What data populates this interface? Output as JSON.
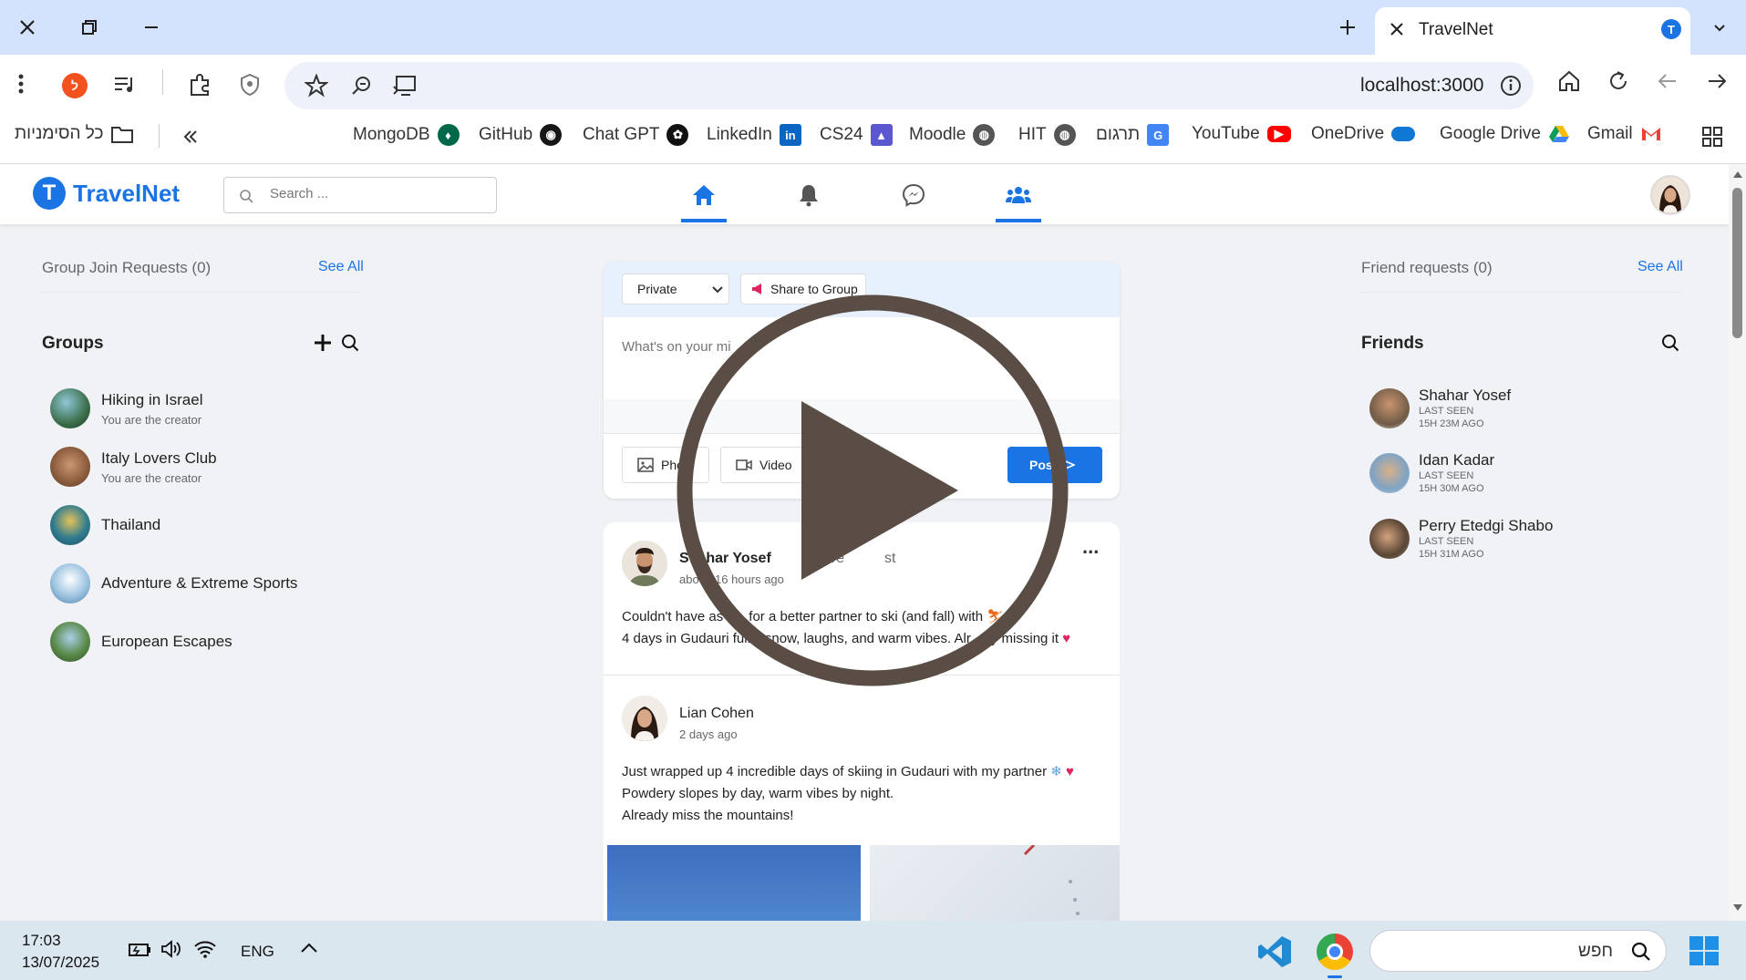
{
  "browser": {
    "tab_title": "TravelNet",
    "url": "localhost:3000",
    "bookmarks": [
      {
        "label": "MongoDB",
        "icon": "mongodb-icon",
        "color": "#00684a"
      },
      {
        "label": "GitHub",
        "icon": "github-icon",
        "color": "#181717"
      },
      {
        "label": "Chat GPT",
        "icon": "chatgpt-icon",
        "color": "#111111"
      },
      {
        "label": "LinkedIn",
        "icon": "linkedin-icon",
        "color": "#0a66c2"
      },
      {
        "label": "CS24",
        "icon": "graduation-cap-icon",
        "color": "#5b57d1"
      },
      {
        "label": "Moodle",
        "icon": "globe-icon",
        "color": "#555555"
      },
      {
        "label": "HIT",
        "icon": "globe-icon",
        "color": "#555555"
      },
      {
        "label": "תרגום",
        "icon": "google-translate-icon",
        "color": "#4285f4"
      },
      {
        "label": "YouTube",
        "icon": "youtube-icon",
        "color": "#ff0000"
      },
      {
        "label": "OneDrive",
        "icon": "onedrive-icon",
        "color": "#0f78d4"
      },
      {
        "label": "Google Drive",
        "icon": "google-drive-icon",
        "color": "#fbbc04"
      },
      {
        "label": "Gmail",
        "icon": "gmail-icon",
        "color": "#ea4335"
      }
    ],
    "all_bookmarks_label": "כל הסימניות"
  },
  "app": {
    "brand": "TravelNet",
    "brand_letter": "T",
    "search_placeholder": "Search ...",
    "accent": "#1b74e4"
  },
  "left": {
    "join_requests_title": "Group Join Requests (0)",
    "see_all": "See All",
    "groups_title": "Groups",
    "groups": [
      {
        "name": "Hiking in Israel",
        "sub": "You are the creator"
      },
      {
        "name": "Italy Lovers Club",
        "sub": "You are the creator"
      },
      {
        "name": "Thailand",
        "sub": ""
      },
      {
        "name": "Adventure & Extreme Sports",
        "sub": ""
      },
      {
        "name": "European Escapes",
        "sub": ""
      }
    ]
  },
  "right": {
    "friend_requests_title": "Friend requests (0)",
    "see_all": "See All",
    "friends_title": "Friends",
    "friends": [
      {
        "name": "Shahar Yosef",
        "last_seen": "LAST SEEN",
        "ago": "15H 23M AGO"
      },
      {
        "name": "Idan Kadar",
        "last_seen": "LAST SEEN",
        "ago": "15H 30M AGO"
      },
      {
        "name": "Perry Etedgi Shabo",
        "last_seen": "LAST SEEN",
        "ago": "15H 31M AGO"
      }
    ]
  },
  "composer": {
    "privacy": "Private",
    "share_group": "Share to Group",
    "placeholder": "What's on your mi",
    "photo": "Pho",
    "video": "Video",
    "post": "Pos"
  },
  "posts": [
    {
      "author": "Shahar Yosef",
      "action_visible": "share",
      "action_tail": "st",
      "author_shown": "S",
      "author_tail": "har Yosef",
      "time_head": "abo",
      "time_tail": "16 hours ago",
      "line1_head": "Couldn't have as",
      "line1_tail": "for a better partner to ski (and fall) with",
      "line2_head": "4 days in Gudauri full",
      "line2_mid": "snow, laughs, and warm vibes. Alr",
      "line2_tail": "y missing it",
      "menu": "..."
    },
    {
      "author": "Lian Cohen",
      "time": "2 days ago",
      "line1": "Just wrapped up 4 incredible days of skiing in Gudauri with my partner",
      "line2": "Powdery slopes by day, warm vibes by night.",
      "line3": "Already miss the mountains!"
    }
  ],
  "taskbar": {
    "time": "17:03",
    "date": "13/07/2025",
    "lang": "ENG",
    "search_text": "חפש"
  }
}
